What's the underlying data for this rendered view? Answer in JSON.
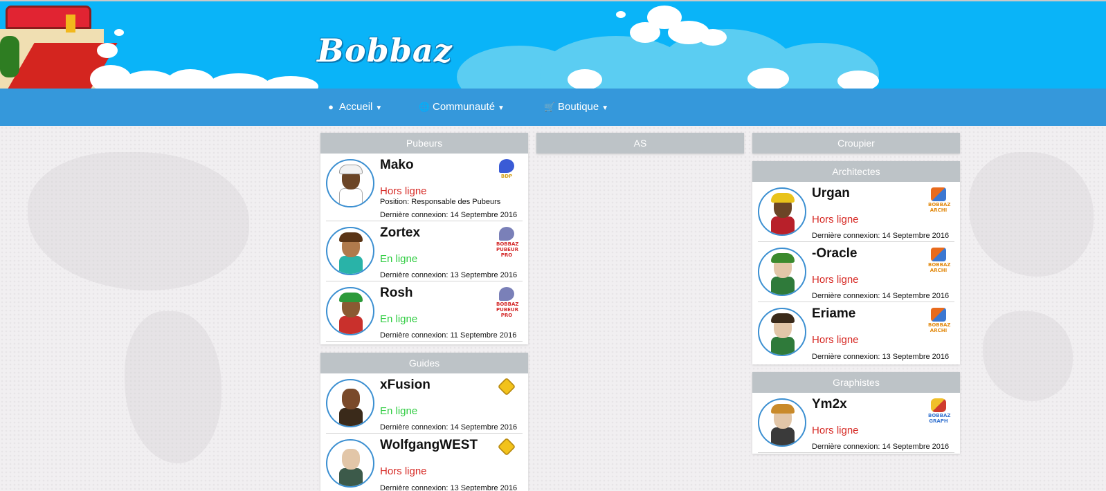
{
  "brand": {
    "name": "Bobbaz"
  },
  "nav": {
    "items": [
      {
        "label": "Accueil",
        "icon": "user-icon"
      },
      {
        "label": "Communauté",
        "icon": "globe-icon"
      },
      {
        "label": "Boutique",
        "icon": "cart-icon"
      }
    ]
  },
  "columns": {
    "left": {
      "panels": [
        {
          "title": "Pubeurs",
          "members": [
            {
              "name": "Mako",
              "status": "Hors ligne",
              "extra": "Position: Responsable des Pubeurs",
              "last": "Dernière connexion: 14 Septembre 2016",
              "badge_text": "BDP"
            },
            {
              "name": "Zortex",
              "status": "En ligne",
              "last": "Dernière connexion: 13 Septembre 2016",
              "badge_text": "BOBBAZ PUBEUR PRO"
            },
            {
              "name": "Rosh",
              "status": "En ligne",
              "last": "Dernière connexion: 11 Septembre 2016",
              "badge_text": "BOBBAZ PUBEUR PRO"
            }
          ]
        },
        {
          "title": "Guides",
          "members": [
            {
              "name": "xFusion",
              "status": "En ligne",
              "last": "Dernière connexion: 14 Septembre 2016"
            },
            {
              "name": "WolfgangWEST",
              "status": "Hors ligne",
              "last": "Dernière connexion: 13 Septembre 2016"
            }
          ]
        }
      ]
    },
    "middle": {
      "panels": [
        {
          "title": "AS"
        }
      ]
    },
    "right": {
      "panels": [
        {
          "title": "Croupier"
        },
        {
          "title": "Architectes",
          "members": [
            {
              "name": "Urgan",
              "status": "Hors ligne",
              "last": "Dernière connexion: 14 Septembre 2016",
              "badge_text": "BOBBAZ ARCHI"
            },
            {
              "name": "-Oracle",
              "status": "Hors ligne",
              "last": "Dernière connexion: 14 Septembre 2016",
              "badge_text": "BOBBAZ ARCHI"
            },
            {
              "name": "Eriame",
              "status": "Hors ligne",
              "last": "Dernière connexion: 13 Septembre 2016",
              "badge_text": "BOBBAZ ARCHI"
            }
          ]
        },
        {
          "title": "Graphistes",
          "members": [
            {
              "name": "Ym2x",
              "status": "Hors ligne",
              "last": "Dernière connexion: 14 Septembre 2016",
              "badge_text": "BOBBAZ GRAPH"
            }
          ]
        }
      ]
    }
  },
  "colors": {
    "banner": "#0ab4f8",
    "navbar": "#3598db",
    "panel_title": "#bdc3c7",
    "offline": "#d62a25",
    "online": "#2ecc40",
    "avatar_ring": "#3b8fd1"
  }
}
